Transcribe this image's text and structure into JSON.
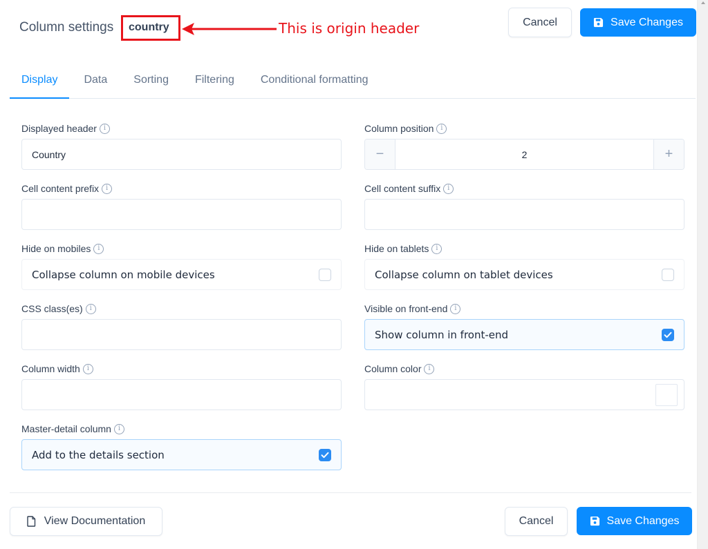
{
  "header": {
    "title": "Column settings",
    "origin_header": "country",
    "annotation": "This is origin header",
    "cancel_label": "Cancel",
    "save_label": "Save Changes"
  },
  "tabs": [
    {
      "label": "Display",
      "active": true
    },
    {
      "label": "Data",
      "active": false
    },
    {
      "label": "Sorting",
      "active": false
    },
    {
      "label": "Filtering",
      "active": false
    },
    {
      "label": "Conditional formatting",
      "active": false
    }
  ],
  "fields": {
    "displayed_header": {
      "label": "Displayed header",
      "value": "Country",
      "info_icon": "info-icon"
    },
    "column_position": {
      "label": "Column position",
      "value": "2",
      "minus": "−",
      "plus": "+"
    },
    "cell_prefix": {
      "label": "Cell content prefix",
      "value": ""
    },
    "cell_suffix": {
      "label": "Cell content suffix",
      "value": ""
    },
    "hide_mobiles": {
      "label": "Hide on mobiles",
      "option": "Collapse column on mobile devices",
      "checked": false
    },
    "hide_tablets": {
      "label": "Hide on tablets",
      "option": "Collapse column on tablet devices",
      "checked": false
    },
    "css_classes": {
      "label": "CSS class(es)",
      "value": ""
    },
    "visible_frontend": {
      "label": "Visible on front-end",
      "option": "Show column in front-end",
      "checked": true
    },
    "column_width": {
      "label": "Column width",
      "value": ""
    },
    "column_color": {
      "label": "Column color",
      "value": ""
    },
    "master_detail": {
      "label": "Master-detail column",
      "option": "Add to the details section",
      "checked": true
    }
  },
  "info_glyph": "i",
  "footer": {
    "doc_label": "View Documentation",
    "cancel_label": "Cancel",
    "save_label": "Save Changes"
  },
  "colors": {
    "accent": "#0a8cff",
    "annotation": "#e8141b"
  }
}
